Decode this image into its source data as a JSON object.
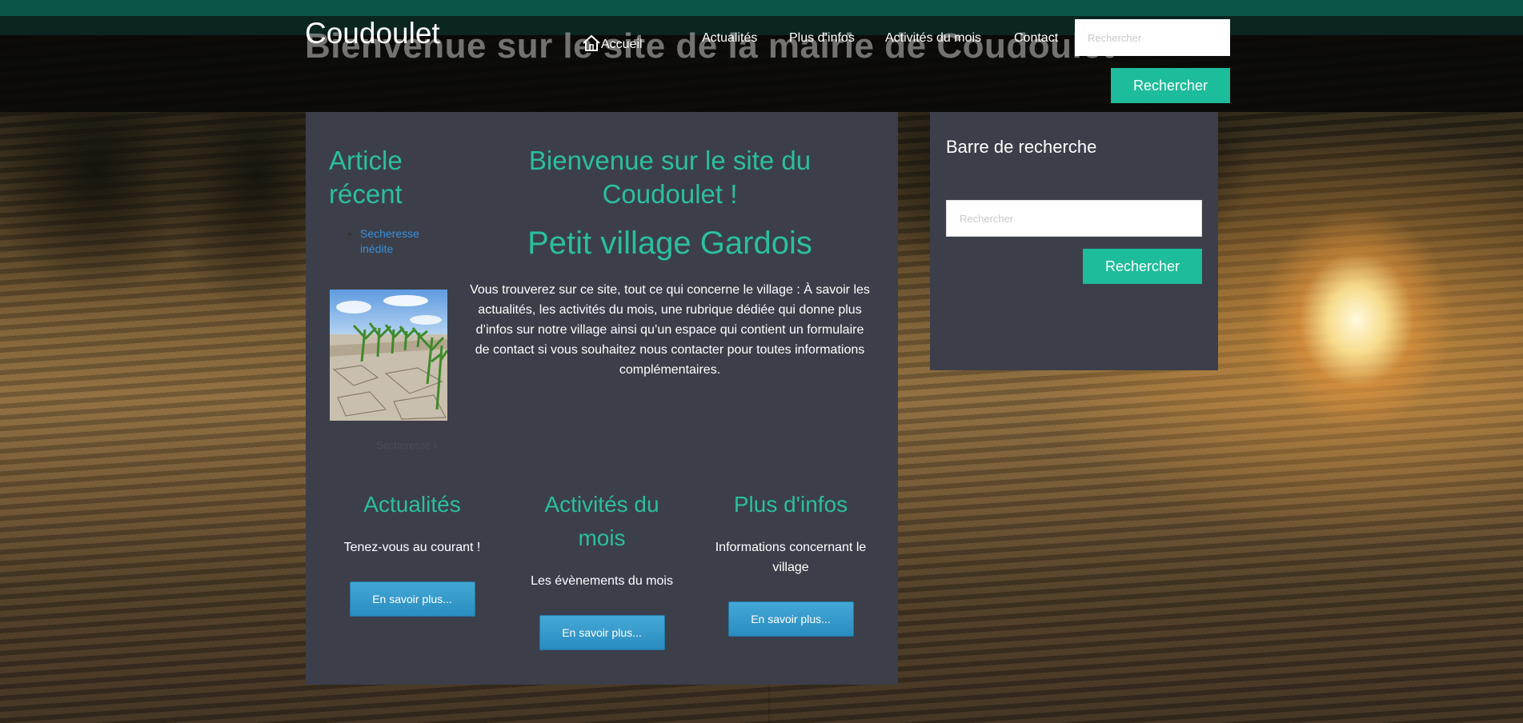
{
  "header": {
    "site_title": "Coudoulet",
    "ghost_title": "Bienvenue sur le site de la mairie de Coudoulet",
    "nav": {
      "home": "Accueil",
      "actualites": "Actualités",
      "plus_infos": "Plus d’infos",
      "activites": "Activités du mois",
      "contact": "Contact"
    },
    "search": {
      "placeholder": "Rechercher",
      "button": "Rechercher"
    }
  },
  "recent": {
    "title": "Article récent",
    "items": [
      {
        "label": "Secheresse inédite"
      }
    ],
    "thumb_caption": "Secheresse i"
  },
  "welcome": {
    "title": "Bienvenue sur le site du Coudoulet !",
    "subtitle": "Petit village Gardois",
    "body": "Vous trouverez sur ce site, tout ce qui concerne le village : À savoir les actualités, les activités du mois, une rubrique dédiée qui donne plus d’infos sur notre village ainsi qu’un espace qui contient un formulaire de contact si vous souhaitez nous contacter pour toutes informations complémentaires."
  },
  "features": [
    {
      "title": "Actualités",
      "text": "Tenez-vous au courant !",
      "button": "En savoir plus..."
    },
    {
      "title": "Activités du mois",
      "text": "Les évènements du mois",
      "button": "En savoir plus..."
    },
    {
      "title": "Plus d'infos",
      "text": "Informations concernant le village",
      "button": "En savoir plus..."
    }
  ],
  "sidebar": {
    "title": "Barre de recherche",
    "search_placeholder": "Rechercher",
    "search_button": "Rechercher"
  },
  "colors": {
    "accent": "#2bbf9f",
    "button_teal": "#1dbc9a",
    "button_blue": "#3399cc",
    "panel": "#3c3f4a",
    "link": "#3b8fd6"
  }
}
